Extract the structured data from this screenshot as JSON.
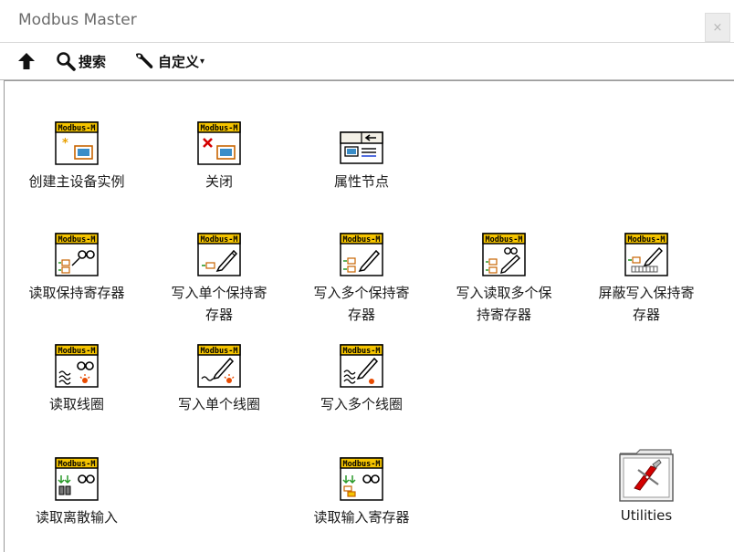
{
  "window": {
    "title": "Modbus Master",
    "close_glyph": "×"
  },
  "toolbar": {
    "up_icon": "up-arrow-icon",
    "search_label": "搜索",
    "customize_label": "自定义",
    "customize_caret": "▾"
  },
  "colors": {
    "icon_header": "#f5c400",
    "icon_border": "#000000",
    "accent_red": "#d40000"
  },
  "palette": {
    "items": [
      {
        "line1": "创建主设备实例",
        "line2": "",
        "icon": "create-master-instance-icon"
      },
      {
        "line1": "关闭",
        "line2": "",
        "icon": "close-instance-icon"
      },
      {
        "line1": "属性节点",
        "line2": "",
        "icon": "property-node-icon"
      },
      {
        "line1": "读取保持寄存器",
        "line2": "",
        "icon": "read-holding-registers-icon"
      },
      {
        "line1": "写入单个保持寄",
        "line2": "存器",
        "icon": "write-single-holding-register-icon"
      },
      {
        "line1": "写入多个保持寄",
        "line2": "存器",
        "icon": "write-multiple-holding-registers-icon"
      },
      {
        "line1": "写入读取多个保",
        "line2": "持寄存器",
        "icon": "write-read-multiple-holding-registers-icon"
      },
      {
        "line1": "屏蔽写入保持寄",
        "line2": "存器",
        "icon": "mask-write-holding-register-icon"
      },
      {
        "line1": "读取线圈",
        "line2": "",
        "icon": "read-coils-icon"
      },
      {
        "line1": "写入单个线圈",
        "line2": "",
        "icon": "write-single-coil-icon"
      },
      {
        "line1": "写入多个线圈",
        "line2": "",
        "icon": "write-multiple-coils-icon"
      },
      {
        "line1": "读取离散输入",
        "line2": "",
        "icon": "read-discrete-inputs-icon"
      },
      {
        "line1": "读取输入寄存器",
        "line2": "",
        "icon": "read-input-registers-icon"
      },
      {
        "line1": "Utilities",
        "line2": "",
        "icon": "utilities-folder-icon"
      }
    ],
    "badge_text": "Modbus-M"
  }
}
